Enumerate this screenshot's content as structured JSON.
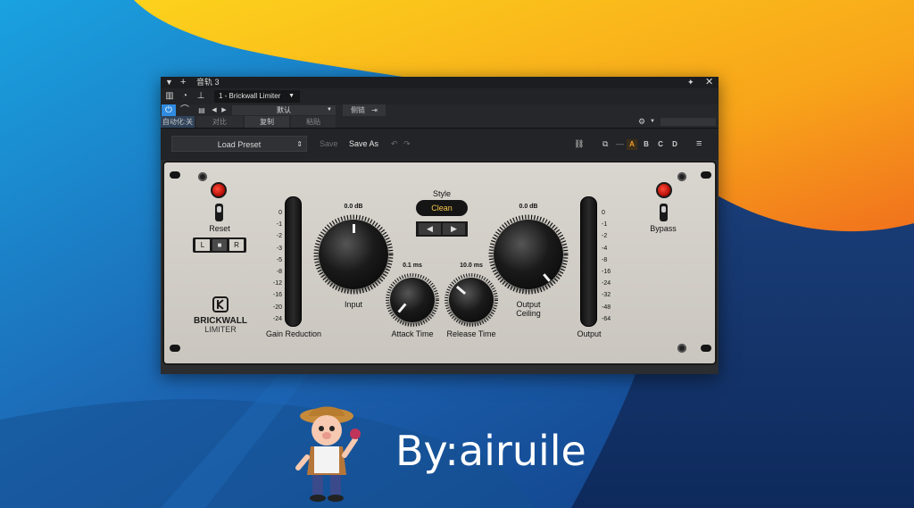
{
  "window": {
    "track_name": "音轨 3",
    "plugin_select": "1 - Brickwall Limiter",
    "preset_default": "默认",
    "sidechain_label": "侧链",
    "auto_label": "自动化:关",
    "compare_label": "对比",
    "copy_label": "复制",
    "paste_label": "粘贴"
  },
  "header": {
    "load_preset": "Load Preset",
    "save": "Save",
    "save_as": "Save As",
    "slots": [
      "A",
      "B",
      "C",
      "D"
    ],
    "active_slot": "A"
  },
  "device": {
    "reset_label": "Reset",
    "bypass_label": "Bypass",
    "channels": [
      "L",
      "■",
      "R"
    ],
    "gain_reduction_label": "Gain Reduction",
    "gain_reduction_scale": [
      "0",
      "-1",
      "-2",
      "-3",
      "-5",
      "-8",
      "-12",
      "-16",
      "-20",
      "-24"
    ],
    "input": {
      "label": "Input",
      "value": "0.0 dB"
    },
    "output_ceiling": {
      "label_line1": "Output",
      "label_line2": "Ceiling",
      "value": "0.0 dB"
    },
    "attack": {
      "label": "Attack Time",
      "value": "0.1 ms"
    },
    "release": {
      "label": "Release Time",
      "value": "10.0 ms"
    },
    "style": {
      "label": "Style",
      "value": "Clean"
    },
    "output_label": "Output",
    "output_scale": [
      "0",
      "-1",
      "-2",
      "-4",
      "-8",
      "-16",
      "-24",
      "-32",
      "-48",
      "-64"
    ],
    "logo_line1": "BRICKWALL",
    "logo_line2": "LIMITER"
  },
  "watermark": {
    "credit": "By:airuile"
  },
  "colors": {
    "style_text": "#f7c84a",
    "active_slot": "#f39a2a",
    "power_button": "#2f8be0",
    "lamp": "#d61a0c"
  }
}
